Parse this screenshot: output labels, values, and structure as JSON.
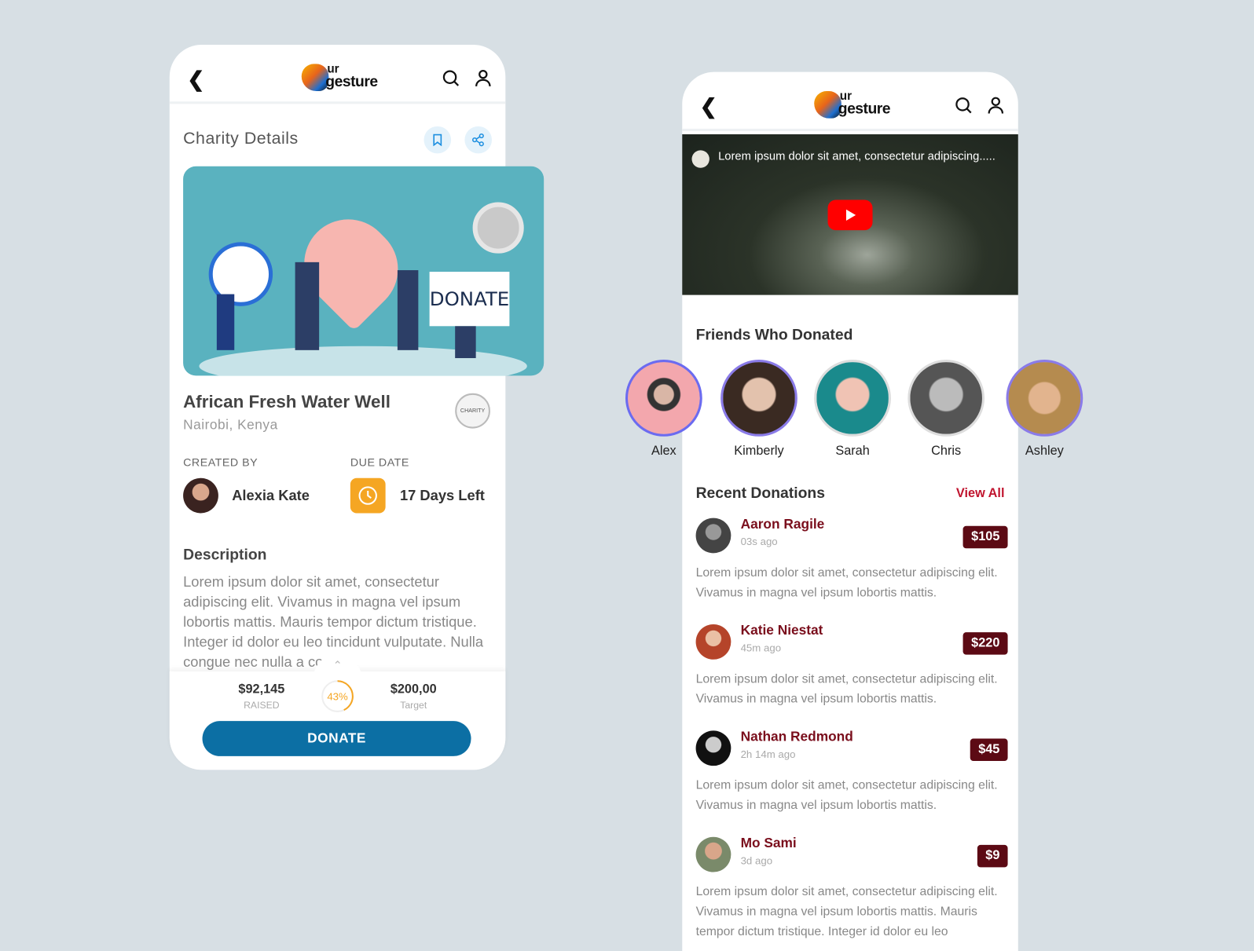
{
  "brand": {
    "logo_text_top": "ur",
    "logo_text_bottom": "gesture"
  },
  "left": {
    "title": "Charity Details",
    "hero_sign": "DONATE",
    "charity_name": "African Fresh Water Well",
    "location": "Nairobi, Kenya",
    "badge_text": "CHARITY",
    "created_by_label": "CREATED BY",
    "creator": "Alexia Kate",
    "due_label": "DUE DATE",
    "due_value": "17 Days Left",
    "description_title": "Description",
    "description": "Lorem ipsum dolor sit amet, consectetur adipiscing elit. Vivamus in magna vel ipsum lobortis mattis. Mauris tempor dictum tristique. Integer id dolor eu leo tincidunt vulputate. Nulla congue nec nulla a congu...",
    "raised": "$92,145",
    "raised_label": "RAISED",
    "progress_percent": 43,
    "progress_label": "43%",
    "target": "$200,00",
    "target_label": "Target",
    "donate_label": "DONATE",
    "colors": {
      "accent": "#0c6fa4",
      "progress": "#f5a623",
      "due_icon": "#f5a623"
    }
  },
  "right": {
    "video_title": "Lorem ipsum dolor sit amet, consectetur adipiscing.....",
    "friends_title": "Friends Who Donated",
    "friends": [
      {
        "name": "Alex"
      },
      {
        "name": "Kimberly"
      },
      {
        "name": "Sarah"
      },
      {
        "name": "Chris"
      },
      {
        "name": "Ashley"
      }
    ],
    "recent_title": "Recent Donations",
    "view_all": "View All",
    "donations": [
      {
        "name": "Aaron Ragile",
        "time": "03s ago",
        "amount": "$105",
        "text": "Lorem ipsum dolor sit amet, consectetur adipiscing elit. Vivamus in magna vel ipsum lobortis mattis."
      },
      {
        "name": "Katie Niestat",
        "time": "45m ago",
        "amount": "$220",
        "text": "Lorem ipsum dolor sit amet, consectetur adipiscing elit. Vivamus in magna vel ipsum lobortis mattis."
      },
      {
        "name": "Nathan Redmond",
        "time": "2h 14m ago",
        "amount": "$45",
        "text": "Lorem ipsum dolor sit amet, consectetur adipiscing elit. Vivamus in magna vel ipsum lobortis mattis."
      },
      {
        "name": "Mo Sami",
        "time": "3d ago",
        "amount": "$9",
        "text": "Lorem ipsum dolor sit amet, consectetur adipiscing elit. Vivamus in magna vel ipsum lobortis mattis. Mauris tempor dictum tristique. Integer id dolor eu leo"
      }
    ],
    "colors": {
      "name": "#7a0e1c",
      "amount_bg": "#5c0a14",
      "view_all": "#c0142e",
      "play": "#ff0000"
    }
  }
}
